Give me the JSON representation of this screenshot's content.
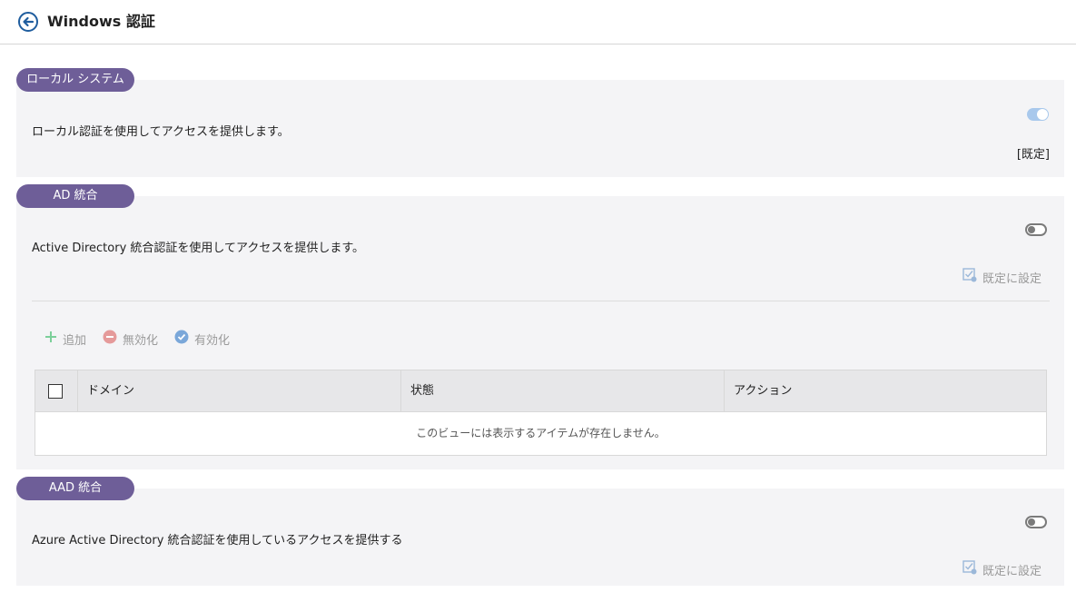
{
  "header": {
    "title": "Windows 認証"
  },
  "sections": {
    "local": {
      "tab": "ローカル システム",
      "description": "ローカル認証を使用してアクセスを提供します。",
      "default_label": "[既定]",
      "enabled": true
    },
    "ad": {
      "tab": "AD 統合",
      "description": "Active Directory 統合認証を使用してアクセスを提供します。",
      "set_default_label": "既定に設定",
      "enabled": false,
      "toolbar": {
        "add": "追加",
        "disable": "無効化",
        "enable": "有効化"
      },
      "table": {
        "columns": [
          "ドメイン",
          "状態",
          "アクション"
        ],
        "empty_message": "このビューには表示するアイテムが存在しません。"
      }
    },
    "aad": {
      "tab": "AAD 統合",
      "description": "Azure Active Directory 統合認証を使用しているアクセスを提供する",
      "set_default_label": "既定に設定",
      "enabled": false
    }
  },
  "colors": {
    "tab_bg": "#6e5e98",
    "panel_bg": "#f4f4f6",
    "toggle_on": "#a8c8ec",
    "add_icon": "#7ccf9a",
    "disable_icon": "#e59a9a",
    "enable_icon": "#7aa7d9"
  }
}
